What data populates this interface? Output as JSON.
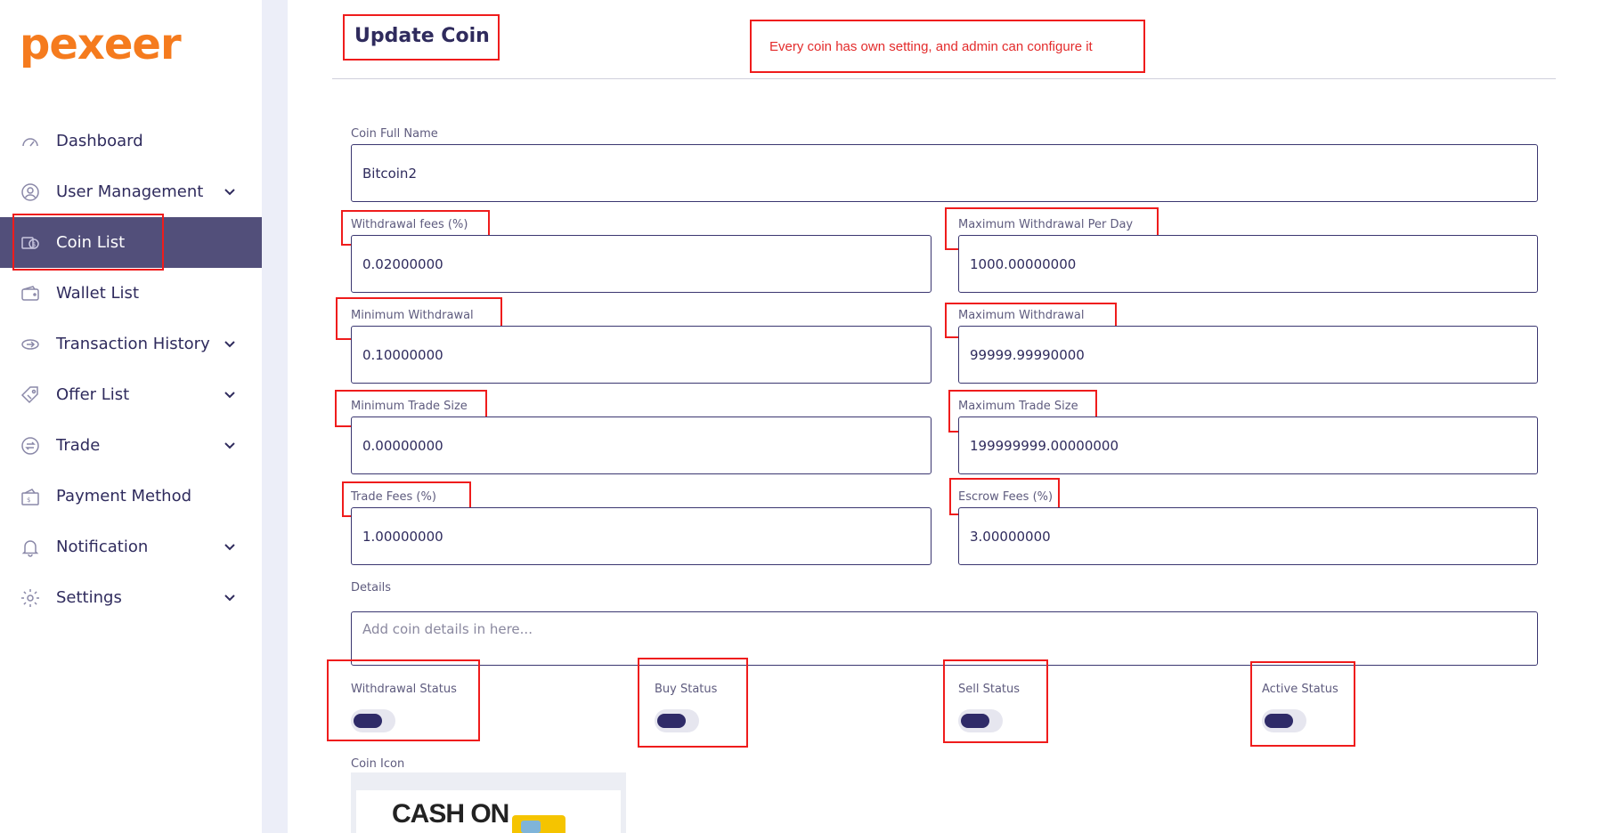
{
  "brand": {
    "logo_text": "pexeer",
    "logo_color": "#f57b1e"
  },
  "sidebar": {
    "items": [
      {
        "label": "Dashboard",
        "icon": "speedometer-icon",
        "has_chevron": false,
        "active": false
      },
      {
        "label": "User Management",
        "icon": "user-circle-icon",
        "has_chevron": true,
        "active": false
      },
      {
        "label": "Coin List",
        "icon": "coin-list-icon",
        "has_chevron": false,
        "active": true
      },
      {
        "label": "Wallet List",
        "icon": "wallet-icon",
        "has_chevron": false,
        "active": false
      },
      {
        "label": "Transaction History",
        "icon": "transaction-icon",
        "has_chevron": true,
        "active": false
      },
      {
        "label": "Offer List",
        "icon": "tag-icon",
        "has_chevron": true,
        "active": false
      },
      {
        "label": "Trade",
        "icon": "exchange-icon",
        "has_chevron": true,
        "active": false
      },
      {
        "label": "Payment Method",
        "icon": "payment-wallet-icon",
        "has_chevron": false,
        "active": false
      },
      {
        "label": "Notification",
        "icon": "bell-icon",
        "has_chevron": true,
        "active": false
      },
      {
        "label": "Settings",
        "icon": "gear-icon",
        "has_chevron": true,
        "active": false
      }
    ]
  },
  "main": {
    "title": "Update Coin",
    "note": "Every coin has own setting, and admin can configure it",
    "form": {
      "coin_full_name": {
        "label": "Coin Full Name",
        "value": "Bitcoin2"
      },
      "withdrawal_fees": {
        "label": "Withdrawal fees (%)",
        "value": "0.02000000"
      },
      "max_withdrawal_per_day": {
        "label": "Maximum Withdrawal Per Day",
        "value": "1000.00000000"
      },
      "min_withdrawal": {
        "label": "Minimum Withdrawal",
        "value": "0.10000000"
      },
      "max_withdrawal": {
        "label": "Maximum Withdrawal",
        "value": "99999.99990000"
      },
      "min_trade_size": {
        "label": "Minimum Trade Size",
        "value": "0.00000000"
      },
      "max_trade_size": {
        "label": "Maximum Trade Size",
        "value": "199999999.00000000"
      },
      "trade_fees": {
        "label": "Trade Fees (%)",
        "value": "1.00000000"
      },
      "escrow_fees": {
        "label": "Escrow Fees (%)",
        "value": "3.00000000"
      },
      "details": {
        "label": "Details",
        "placeholder": "Add coin details in here..."
      },
      "withdrawal_status": {
        "label": "Withdrawal Status"
      },
      "buy_status": {
        "label": "Buy Status"
      },
      "sell_status": {
        "label": "Sell Status"
      },
      "active_status": {
        "label": "Active Status"
      },
      "coin_icon": {
        "label": "Coin Icon",
        "image_text": "CASH ON"
      }
    }
  },
  "colors": {
    "accent": "#2f2b5d",
    "active_nav": "#524f7a",
    "highlight": "#ef1c1c"
  }
}
